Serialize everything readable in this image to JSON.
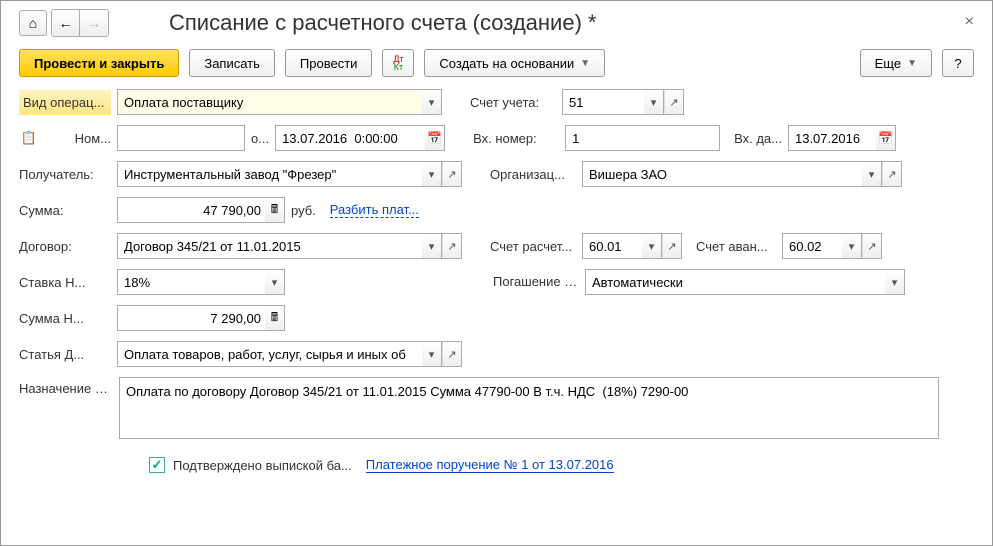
{
  "title": "Списание с расчетного счета (создание) *",
  "toolbar": {
    "post_close": "Провести и закрыть",
    "save": "Записать",
    "post": "Провести",
    "create_based": "Создать на основании",
    "more": "Еще"
  },
  "labels": {
    "op_type": "Вид операц...",
    "number": "Ном...",
    "from": "о...",
    "recipient": "Получатель:",
    "sum": "Сумма:",
    "rub": "руб.",
    "split": "Разбить плат...",
    "contract": "Договор:",
    "vat_rate": "Ставка Н...",
    "vat_sum": "Сумма Н...",
    "article": "Статья Д...",
    "purpose": "Назначение платежа:",
    "account": "Счет учета:",
    "in_number": "Вх. номер:",
    "in_date": "Вх. да...",
    "org": "Организац...",
    "settle_acc": "Счет расчет...",
    "advance_acc": "Счет аван...",
    "debt_settle": "Погашение задолженно...",
    "confirmed": "Подтверждено выпиской ба...",
    "payment_order": "Платежное поручение № 1 от 13.07.2016"
  },
  "values": {
    "op_type": "Оплата поставщику",
    "number": "",
    "date": "13.07.2016  0:00:00",
    "recipient": "Инструментальный завод \"Фрезер\"",
    "sum": "47 790,00",
    "contract": "Договор 345/21 от 11.01.2015",
    "vat_rate": "18%",
    "vat_sum": "7 290,00",
    "article": "Оплата товаров, работ, услуг, сырья и иных об",
    "account": "51",
    "in_number": "1",
    "in_date": "13.07.2016",
    "org": "Вишера ЗАО",
    "settle_acc": "60.01",
    "advance_acc": "60.02",
    "debt_settle": "Автоматически",
    "purpose": "Оплата по договору Договор 345/21 от 11.01.2015 Сумма 47790-00 В т.ч. НДС  (18%) 7290-00"
  }
}
